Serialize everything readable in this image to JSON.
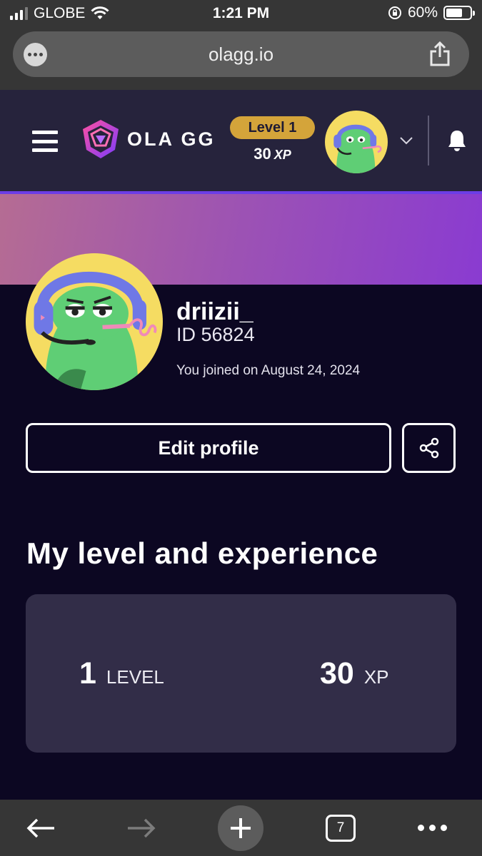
{
  "status_bar": {
    "carrier": "GLOBE",
    "time": "1:21 PM",
    "battery_percent": "60%",
    "battery_level": 0.6
  },
  "browser": {
    "url": "olagg.io",
    "tab_count": "7"
  },
  "header": {
    "logo_text": "OLA GG",
    "level_label": "Level 1",
    "xp_value": "30",
    "xp_unit": "XP",
    "colors": {
      "accent_purple": "#6c3de6",
      "level_gold": "#d4a43a",
      "header_bg": "#26233c"
    }
  },
  "profile": {
    "username": "driizii_",
    "id_text": "ID 56824",
    "joined_text": "You joined on August 24, 2024",
    "edit_button": "Edit profile"
  },
  "experience": {
    "section_title": "My level and experience",
    "level_value": "1",
    "level_unit": "LEVEL",
    "xp_value": "30",
    "xp_unit": "XP"
  },
  "icons": {
    "menu": "hamburger-icon",
    "notifications": "bell-icon",
    "share": "share-icon",
    "dropdown": "chevron-down-icon"
  }
}
